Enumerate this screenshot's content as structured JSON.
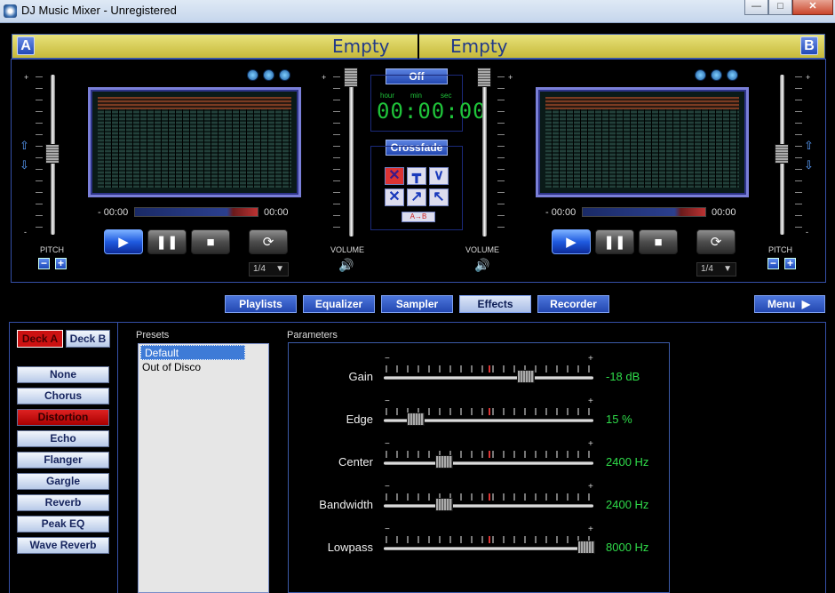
{
  "window": {
    "title": "DJ Music Mixer - Unregistered",
    "minimize": "—",
    "maximize": "□",
    "close": "✕"
  },
  "decks": {
    "a": {
      "letter": "A",
      "name": "Empty",
      "time_left": "- 00:00",
      "time_right": "00:00",
      "speed": "1/4",
      "pitch_label": "PITCH",
      "volume_label": "VOLUME"
    },
    "b": {
      "letter": "B",
      "name": "Empty",
      "time_left": "- 00:00",
      "time_right": "00:00",
      "speed": "1/4",
      "pitch_label": "PITCH",
      "volume_label": "VOLUME"
    }
  },
  "center": {
    "timer_button": "Off",
    "hour": "hour",
    "min": "min",
    "sec": "sec",
    "digits": "00:00:00",
    "crossfade_button": "Crossfade",
    "ab_label": "A→B"
  },
  "tabs": [
    "Playlists",
    "Equalizer",
    "Sampler",
    "Effects",
    "Recorder"
  ],
  "menu_label": "Menu",
  "effects": {
    "deck_a": "Deck A",
    "deck_b": "Deck B",
    "list": [
      "None",
      "Chorus",
      "Distortion",
      "Echo",
      "Flanger",
      "Gargle",
      "Reverb",
      "Peak EQ",
      "Wave Reverb"
    ],
    "active": "Distortion",
    "presets_title": "Presets",
    "presets": [
      "Default",
      "Out of Disco"
    ],
    "parameters_title": "Parameters",
    "parameters": [
      {
        "name": "Gain",
        "value": "-18 dB",
        "level": 0.7
      },
      {
        "name": "Edge",
        "value": "15 %",
        "level": 0.15
      },
      {
        "name": "Center",
        "value": "2400 Hz",
        "level": 0.29
      },
      {
        "name": "Bandwidth",
        "value": "2400 Hz",
        "level": 0.29
      },
      {
        "name": "Lowpass",
        "value": "8000 Hz",
        "level": 1.0
      }
    ]
  },
  "colors": {
    "accent": "#2348b2",
    "active_red": "#cc1111",
    "value_green": "#2fdc4a",
    "header_yellow": "#d8d055"
  }
}
